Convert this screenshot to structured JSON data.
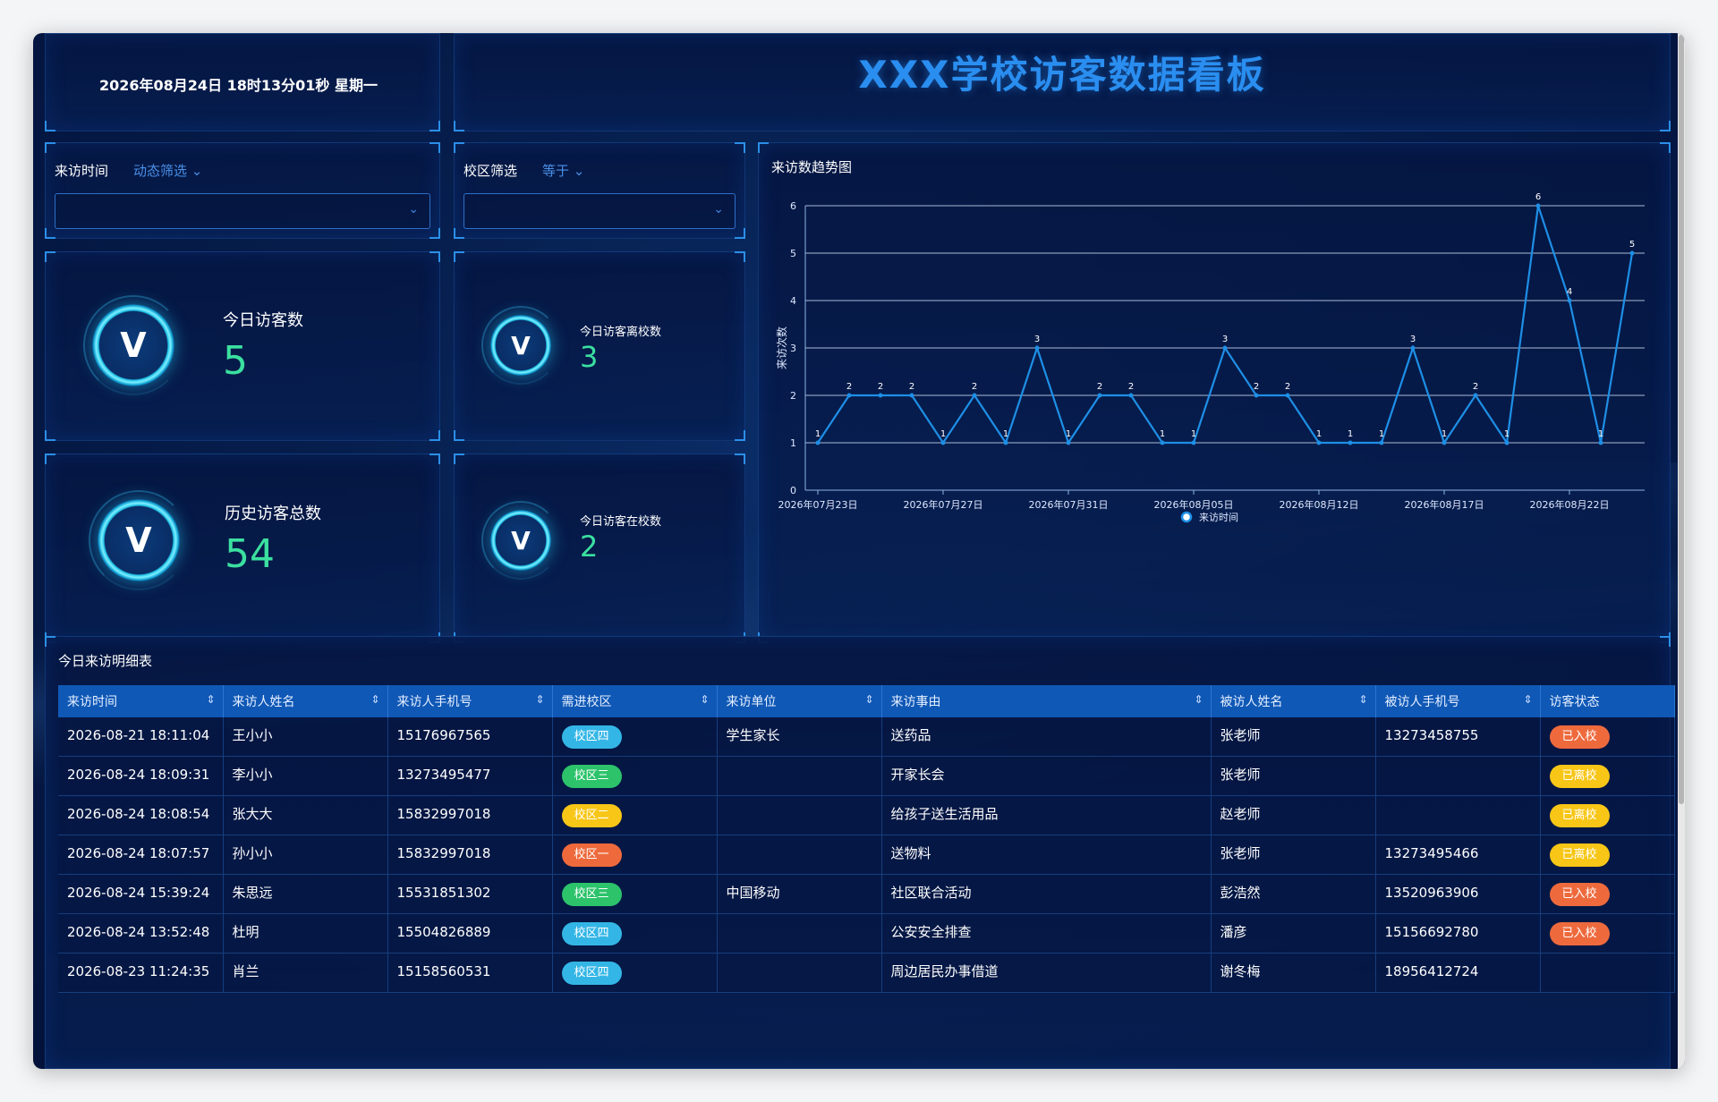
{
  "header": {
    "datetime": "2026年08月24日 18时13分01秒 星期一",
    "title": "XXX学校访客数据看板"
  },
  "filters": {
    "time": {
      "label": "来访时间",
      "mode": "动态筛选"
    },
    "campus": {
      "label": "校区筛选",
      "mode": "等于"
    }
  },
  "stats": {
    "today_visitors": {
      "label": "今日访客数",
      "value": "5"
    },
    "total_visitors": {
      "label": "历史访客总数",
      "value": "54"
    },
    "today_left": {
      "label": "今日访客离校数",
      "value": "3"
    },
    "today_in_school": {
      "label": "今日访客在校数",
      "value": "2"
    }
  },
  "chart_data": {
    "type": "line",
    "title": "来访数趋势图",
    "ylabel": "来访次数",
    "xlabel": "",
    "ylim": [
      0,
      6
    ],
    "yticks": [
      0,
      1,
      2,
      3,
      4,
      5,
      6
    ],
    "xtick_labels": [
      "2026年07月23日",
      "2026年07月27日",
      "2026年07月31日",
      "2026年08月05日",
      "2026年08月12日",
      "2026年08月17日",
      "2026年08月22日"
    ],
    "series": [
      {
        "name": "来访时间",
        "values": [
          1,
          2,
          2,
          2,
          1,
          2,
          1,
          3,
          1,
          2,
          2,
          1,
          1,
          3,
          2,
          2,
          1,
          1,
          1,
          3,
          1,
          2,
          1,
          6,
          4,
          1,
          5
        ]
      }
    ],
    "legend": "bottom-center",
    "color": "#1e8fe6"
  },
  "table": {
    "title": "今日来访明细表",
    "columns": [
      "来访时间",
      "来访人姓名",
      "来访人手机号",
      "需进校区",
      "来访单位",
      "来访事由",
      "被访人姓名",
      "被访人手机号",
      "访客状态"
    ],
    "rows": [
      {
        "time": "2026-08-21 18:11:04",
        "name": "王小小",
        "phone": "15176967565",
        "campus": "校区四",
        "campus_color": "cyan",
        "unit": "学生家长",
        "reason": "送药品",
        "host": "张老师",
        "host_phone": "13273458755",
        "status": "已入校",
        "status_color": "red"
      },
      {
        "time": "2026-08-24 18:09:31",
        "name": "李小小",
        "phone": "13273495477",
        "campus": "校区三",
        "campus_color": "green",
        "unit": "",
        "reason": "开家长会",
        "host": "张老师",
        "host_phone": "",
        "status": "已离校",
        "status_color": "yellow"
      },
      {
        "time": "2026-08-24 18:08:54",
        "name": "张大大",
        "phone": "15832997018",
        "campus": "校区二",
        "campus_color": "yellow",
        "unit": "",
        "reason": "给孩子送生活用品",
        "host": "赵老师",
        "host_phone": "",
        "status": "已离校",
        "status_color": "yellow"
      },
      {
        "time": "2026-08-24 18:07:57",
        "name": "孙小小",
        "phone": "15832997018",
        "campus": "校区一",
        "campus_color": "red",
        "unit": "",
        "reason": "送物料",
        "host": "张老师",
        "host_phone": "13273495466",
        "status": "已离校",
        "status_color": "yellow"
      },
      {
        "time": "2026-08-24 15:39:24",
        "name": "朱思远",
        "phone": "15531851302",
        "campus": "校区三",
        "campus_color": "green",
        "unit": "中国移动",
        "reason": "社区联合活动",
        "host": "彭浩然",
        "host_phone": "13520963906",
        "status": "已入校",
        "status_color": "red"
      },
      {
        "time": "2026-08-24 13:52:48",
        "name": "杜明",
        "phone": "15504826889",
        "campus": "校区四",
        "campus_color": "cyan",
        "unit": "",
        "reason": "公安安全排查",
        "host": "潘彦",
        "host_phone": "15156692780",
        "status": "已入校",
        "status_color": "red"
      },
      {
        "time": "2026-08-23 11:24:35",
        "name": "肖兰",
        "phone": "15158560531",
        "campus": "校区四",
        "campus_color": "cyan",
        "unit": "",
        "reason": "周边居民办事借道",
        "host": "谢冬梅",
        "host_phone": "18956412724",
        "status": "",
        "status_color": ""
      }
    ]
  }
}
